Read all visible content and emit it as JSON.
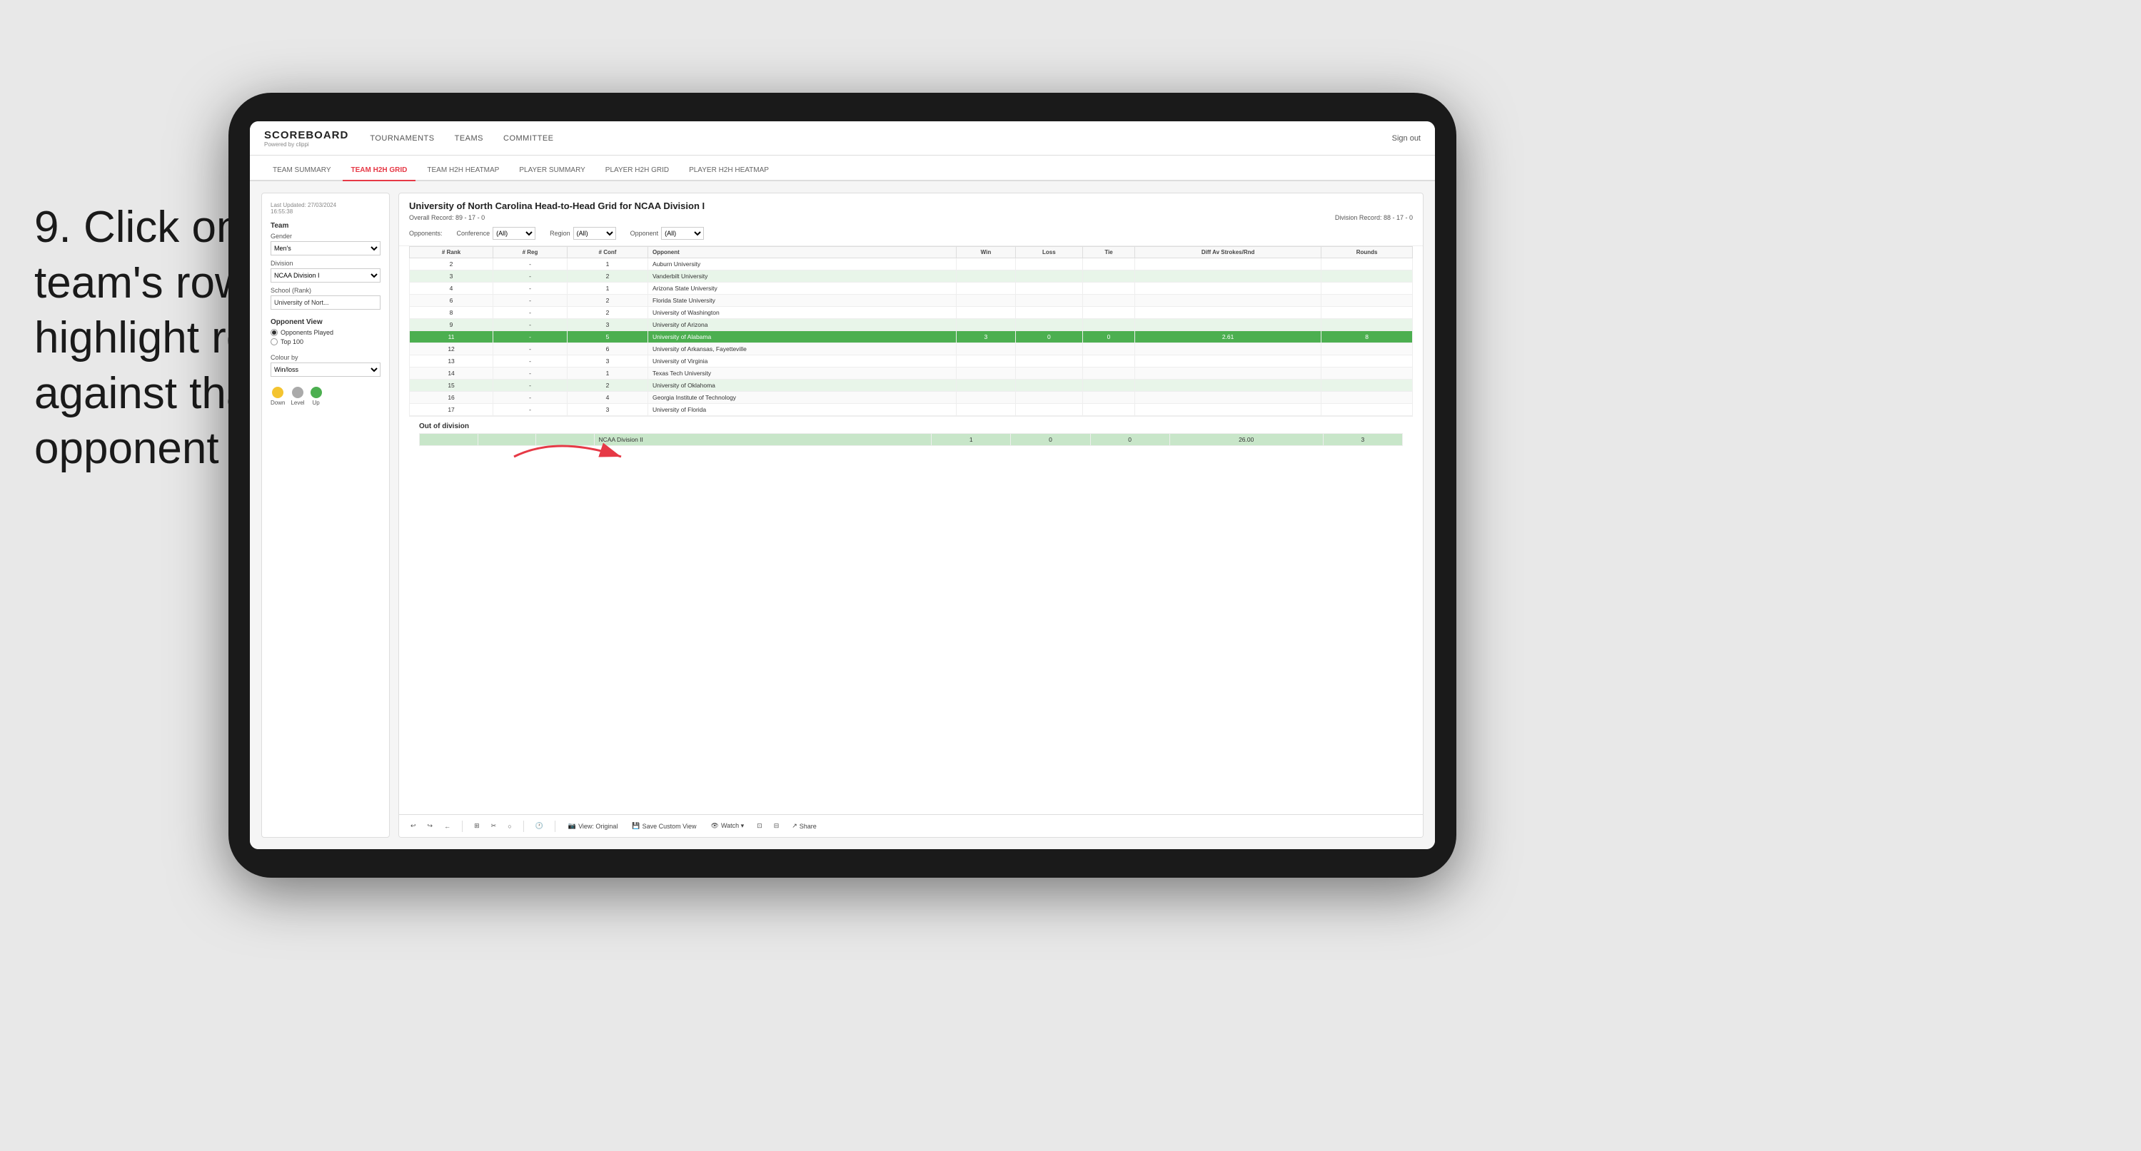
{
  "instruction": {
    "step": "9.",
    "text": "Click on a team's row to highlight results against that opponent"
  },
  "nav": {
    "logo": "SCOREBOARD",
    "logo_sub": "Powered by clippi",
    "links": [
      "TOURNAMENTS",
      "TEAMS",
      "COMMITTEE"
    ],
    "sign_out": "Sign out"
  },
  "sub_tabs": [
    {
      "label": "TEAM SUMMARY",
      "active": false
    },
    {
      "label": "TEAM H2H GRID",
      "active": true
    },
    {
      "label": "TEAM H2H HEATMAP",
      "active": false
    },
    {
      "label": "PLAYER SUMMARY",
      "active": false
    },
    {
      "label": "PLAYER H2H GRID",
      "active": false
    },
    {
      "label": "PLAYER H2H HEATMAP",
      "active": false
    }
  ],
  "left_panel": {
    "last_updated_label": "Last Updated: 27/03/2024",
    "time": "16:55:38",
    "team_label": "Team",
    "gender_label": "Gender",
    "gender_value": "Men's",
    "division_label": "Division",
    "division_value": "NCAA Division I",
    "school_label": "School (Rank)",
    "school_value": "University of Nort...",
    "opponent_view_label": "Opponent View",
    "radio_opponents": "Opponents Played",
    "radio_top100": "Top 100",
    "colour_by_label": "Colour by",
    "colour_by_value": "Win/loss",
    "legend": [
      {
        "label": "Down",
        "color": "#f4c430"
      },
      {
        "label": "Level",
        "color": "#aaaaaa"
      },
      {
        "label": "Up",
        "color": "#4caf50"
      }
    ]
  },
  "grid": {
    "title": "University of North Carolina Head-to-Head Grid for NCAA Division I",
    "overall_record_label": "Overall Record:",
    "overall_record": "89 - 17 - 0",
    "division_record_label": "Division Record:",
    "division_record": "88 - 17 - 0",
    "filters": {
      "conference_label": "Conference",
      "conference_value": "(All)",
      "region_label": "Region",
      "region_value": "(All)",
      "opponent_label": "Opponent",
      "opponent_value": "(All)",
      "opponents_label": "Opponents:"
    },
    "columns": [
      "# Rank",
      "# Reg",
      "# Conf",
      "Opponent",
      "Win",
      "Loss",
      "Tie",
      "Diff Av Strokes/Rnd",
      "Rounds"
    ],
    "rows": [
      {
        "rank": "2",
        "reg": "-",
        "conf": "1",
        "opponent": "Auburn University",
        "win": "",
        "loss": "",
        "tie": "",
        "diff": "",
        "rounds": "",
        "style": "normal"
      },
      {
        "rank": "3",
        "reg": "-",
        "conf": "2",
        "opponent": "Vanderbilt University",
        "win": "",
        "loss": "",
        "tie": "",
        "diff": "",
        "rounds": "",
        "style": "light-green"
      },
      {
        "rank": "4",
        "reg": "-",
        "conf": "1",
        "opponent": "Arizona State University",
        "win": "",
        "loss": "",
        "tie": "",
        "diff": "",
        "rounds": "",
        "style": "normal"
      },
      {
        "rank": "6",
        "reg": "-",
        "conf": "2",
        "opponent": "Florida State University",
        "win": "",
        "loss": "",
        "tie": "",
        "diff": "",
        "rounds": "",
        "style": "normal"
      },
      {
        "rank": "8",
        "reg": "-",
        "conf": "2",
        "opponent": "University of Washington",
        "win": "",
        "loss": "",
        "tie": "",
        "diff": "",
        "rounds": "",
        "style": "normal"
      },
      {
        "rank": "9",
        "reg": "-",
        "conf": "3",
        "opponent": "University of Arizona",
        "win": "",
        "loss": "",
        "tie": "",
        "diff": "",
        "rounds": "",
        "style": "light-green"
      },
      {
        "rank": "11",
        "reg": "-",
        "conf": "5",
        "opponent": "University of Alabama",
        "win": "3",
        "loss": "0",
        "tie": "0",
        "diff": "2.61",
        "rounds": "8",
        "style": "highlighted"
      },
      {
        "rank": "12",
        "reg": "-",
        "conf": "6",
        "opponent": "University of Arkansas, Fayetteville",
        "win": "",
        "loss": "",
        "tie": "",
        "diff": "",
        "rounds": "",
        "style": "normal"
      },
      {
        "rank": "13",
        "reg": "-",
        "conf": "3",
        "opponent": "University of Virginia",
        "win": "",
        "loss": "",
        "tie": "",
        "diff": "",
        "rounds": "",
        "style": "normal"
      },
      {
        "rank": "14",
        "reg": "-",
        "conf": "1",
        "opponent": "Texas Tech University",
        "win": "",
        "loss": "",
        "tie": "",
        "diff": "",
        "rounds": "",
        "style": "normal"
      },
      {
        "rank": "15",
        "reg": "-",
        "conf": "2",
        "opponent": "University of Oklahoma",
        "win": "",
        "loss": "",
        "tie": "",
        "diff": "",
        "rounds": "",
        "style": "light-green"
      },
      {
        "rank": "16",
        "reg": "-",
        "conf": "4",
        "opponent": "Georgia Institute of Technology",
        "win": "",
        "loss": "",
        "tie": "",
        "diff": "",
        "rounds": "",
        "style": "normal"
      },
      {
        "rank": "17",
        "reg": "-",
        "conf": "3",
        "opponent": "University of Florida",
        "win": "",
        "loss": "",
        "tie": "",
        "diff": "",
        "rounds": "",
        "style": "normal"
      }
    ],
    "out_of_division_label": "Out of division",
    "ood_row": {
      "division": "NCAA Division II",
      "win": "1",
      "loss": "0",
      "tie": "0",
      "diff": "26.00",
      "rounds": "3"
    }
  },
  "toolbar": {
    "undo": "↩",
    "redo": "↪",
    "back": "←",
    "view_original": "View: Original",
    "save_custom": "Save Custom View",
    "watch": "Watch ▾",
    "share": "Share"
  }
}
